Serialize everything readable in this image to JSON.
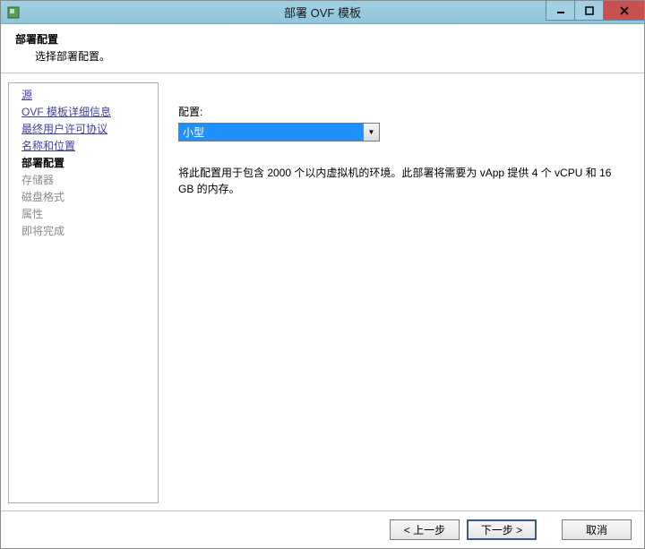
{
  "window": {
    "title": "部署 OVF 模板"
  },
  "header": {
    "title": "部署配置",
    "subtitle": "选择部署配置。"
  },
  "sidebar": {
    "items": [
      {
        "label": "源",
        "state": "link"
      },
      {
        "label": "OVF 模板详细信息",
        "state": "link"
      },
      {
        "label": "最终用户许可协议",
        "state": "link"
      },
      {
        "label": "名称和位置",
        "state": "link"
      },
      {
        "label": "部署配置",
        "state": "active"
      },
      {
        "label": "存储器",
        "state": "disabled"
      },
      {
        "label": "磁盘格式",
        "state": "disabled"
      },
      {
        "label": "属性",
        "state": "disabled"
      },
      {
        "label": "即将完成",
        "state": "disabled"
      }
    ]
  },
  "content": {
    "config_label": "配置:",
    "config_value": "小型",
    "description": "将此配置用于包含 2000 个以内虚拟机的环境。此部署将需要为 vApp 提供 4 个 vCPU 和 16 GB 的内存。"
  },
  "footer": {
    "back": "< 上一步",
    "next": "下一步 >",
    "cancel": "取消"
  }
}
